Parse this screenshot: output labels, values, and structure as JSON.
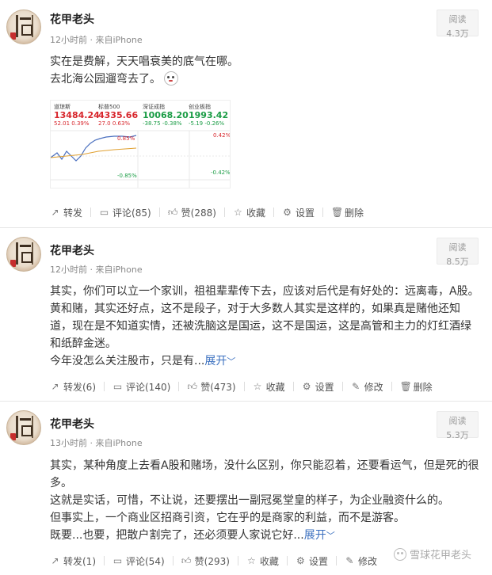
{
  "posts": [
    {
      "author": "花甲老头",
      "meta": "12小时前 · 来自iPhone",
      "read_label": "阅读",
      "read_count": "4.3万",
      "lines": [
        "实在是费解，天天唱衰美的底气在哪。",
        "去北海公园遛弯去了。"
      ],
      "actions": {
        "repost": "转发",
        "comment": "评论(85)",
        "like": "赞(288)",
        "favorite": "收藏",
        "settings": "设置",
        "delete": "删除"
      },
      "quote_card": {
        "quotes": [
          {
            "name": "道琼斯",
            "value": "13484.24",
            "change": "52.01",
            "pct": "0.39%",
            "color": "#d8262c"
          },
          {
            "name": "标普500",
            "value": "4335.66",
            "change": "27.0",
            "pct": "0.63%",
            "color": "#d8262c"
          },
          {
            "name": "深证成指",
            "value": "10068.20",
            "change": "-38.75",
            "pct": "-0.38%",
            "color": "#1a9c45"
          },
          {
            "name": "创业板指",
            "value": "1993.42",
            "change": "-5.19",
            "pct": "-0.26%",
            "color": "#1a9c45"
          }
        ],
        "left_axis": {
          "top": "0.85%",
          "bottom": "-0.85%"
        },
        "right_axis": {
          "top": "0.42%",
          "bottom": "-0.42%"
        }
      }
    },
    {
      "author": "花甲老头",
      "meta": "12小时前 · 来自iPhone",
      "read_label": "阅读",
      "read_count": "8.5万",
      "lines": [
        "其实，你们可以立一个家训，祖祖辈辈传下去，应该对后代是有好处的：远离毒，A股。",
        "黄和赌，其实还好点，这不是段子，对于大多数人其实是这样的，如果真是赌他还知",
        "道，现在是不知道实情，还被洗脑这是国运，这不是国运，这是高管和主力的灯红酒绿",
        "和纸醉金迷。",
        "今年没怎么关注股市，只是有..."
      ],
      "expand_label": "展开",
      "actions": {
        "repost": "转发(6)",
        "comment": "评论(140)",
        "like": "赞(473)",
        "favorite": "收藏",
        "settings": "设置",
        "edit": "修改",
        "delete": "删除"
      }
    },
    {
      "author": "花甲老头",
      "meta": "13小时前 · 来自iPhone",
      "read_label": "阅读",
      "read_count": "5.3万",
      "lines": [
        "其实，某种角度上去看A股和赌场，没什么区别，你只能忍着，还要看运气，但是死的很",
        "多。",
        "这就是实话，可惜，不让说，还要摆出一副冠冕堂皇的样子，为企业融资什么的。",
        "但事实上，一个商业区招商引资，它在乎的是商家的利益，而不是游客。",
        "既要...也要，把散户割完了，还必须要人家说它好..."
      ],
      "expand_label": "展开",
      "actions": {
        "repost": "转发(1)",
        "comment": "评论(54)",
        "like": "赞(293)",
        "favorite": "收藏",
        "settings": "设置",
        "edit": "修改"
      }
    }
  ],
  "watermark": "雪球花甲老头"
}
